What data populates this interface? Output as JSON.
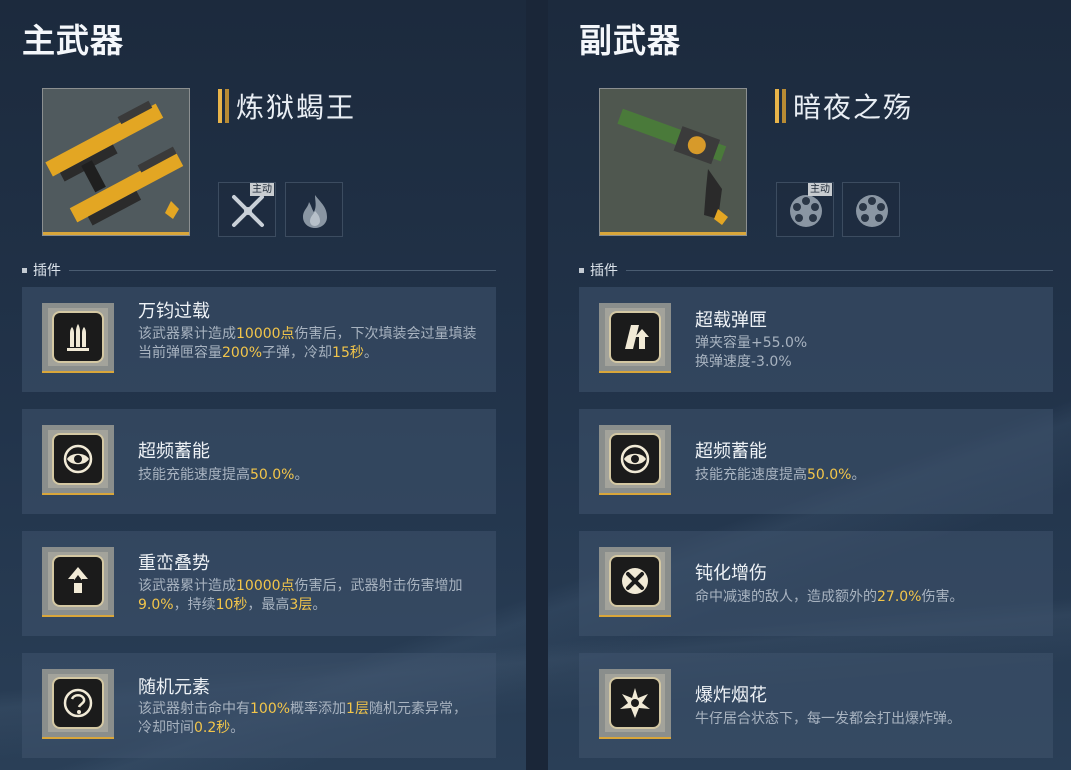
{
  "colors": {
    "accent_gold": "#f2c54a",
    "stat_green": "#8fd18a",
    "panel": "#40546e"
  },
  "left": {
    "section_title": "主武器",
    "weapon_name": "炼狱蝎王",
    "skills": [
      {
        "icon": "crossed-guns-icon",
        "tag": "主动"
      },
      {
        "icon": "flame-icon",
        "tag": ""
      }
    ],
    "plugin_header": "插件",
    "plugins": [
      {
        "icon": "triple-bullet-icon",
        "title": "万钧过载",
        "d1": "该武器累计造成",
        "h1": "10000点",
        "d2": "伤害后，下次填装会过量填装当前弹匣容量",
        "h2": "200%",
        "d3": "子弹，冷却",
        "h3": "15秒",
        "d4": "。"
      },
      {
        "icon": "eye-icon",
        "title": "超频蓄能",
        "d1": "技能充能速度提高",
        "h1": "50.0%",
        "d2": "。"
      },
      {
        "icon": "arrow-up-icon",
        "title": "重峦叠势",
        "d1": "该武器累计造成",
        "h1": "10000点",
        "d2": "伤害后，武器射击伤害增加",
        "h2": "9.0%",
        "d3": "，持续",
        "h3": "10秒",
        "d4": "，最高",
        "h4": "3层",
        "d5": "。"
      },
      {
        "icon": "random-element-icon",
        "title": "随机元素",
        "d1": "该武器射击命中有",
        "h1": "100%",
        "d2": "概率添加",
        "h2": "1层",
        "d3": "随机元素异常，冷却时间",
        "h3": "0.2秒",
        "d4": "。"
      }
    ]
  },
  "right": {
    "section_title": "副武器",
    "weapon_name": "暗夜之殇",
    "skills": [
      {
        "icon": "revolver-cylinder-icon",
        "tag": "主动"
      },
      {
        "icon": "revolver-cylinder-icon",
        "tag": ""
      }
    ],
    "plugin_header": "插件",
    "plugins": [
      {
        "icon": "magazine-up-icon",
        "title": "超载弹匣",
        "s1": "弹夹容量+55.0%",
        "s2": "换弹速度-3.0%"
      },
      {
        "icon": "eye-icon",
        "title": "超频蓄能",
        "d1": "技能充能速度提高",
        "h1": "50.0%",
        "d2": "。"
      },
      {
        "icon": "crossed-blade-icon",
        "title": "钝化增伤",
        "d1": "命中减速的敌人，造成额外的",
        "h1": "27.0%",
        "d2": "伤害。"
      },
      {
        "icon": "explosion-icon",
        "title": "爆炸烟花",
        "d1": "牛仔居合状态下，每一发都会打出爆炸弹。"
      }
    ]
  }
}
